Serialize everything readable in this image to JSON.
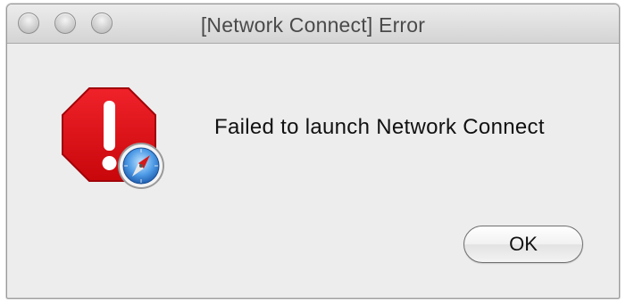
{
  "window": {
    "title": "[Network Connect] Error"
  },
  "alert": {
    "icon": "stop-sign-with-safari-badge-icon",
    "message": "Failed to launch Network Connect"
  },
  "buttons": {
    "ok_label": "OK"
  },
  "colors": {
    "stop_sign": "#d80e10",
    "safari_blue": "#3d86d8"
  }
}
